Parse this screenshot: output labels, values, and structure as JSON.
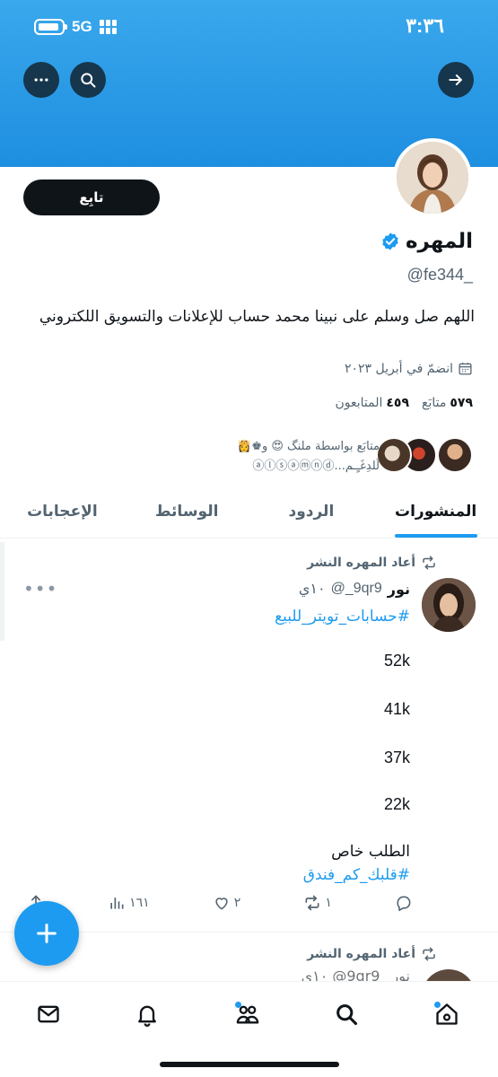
{
  "status_bar": {
    "time": "٣:٣٦",
    "network": "5G"
  },
  "header": {
    "back_icon": "arrow-right-icon",
    "search_icon": "search-icon",
    "more_icon": "more-icon"
  },
  "profile": {
    "follow_label": "تابِع",
    "name": "المهره",
    "handle": "@fe344_",
    "bio": "اللهم صل وسلم على نبينا محمد حساب للإعلانات والتسويق اللكتروني",
    "joined": "انضمّ في أبريل ٢٠٢٣",
    "following_count": "٥٧٩",
    "following_label": "متابَع",
    "followers_count": "٤٥٩",
    "followers_label": "المتابعون",
    "followed_by_line1": "متابَع بواسطة ملنگ 😍 و♚👸",
    "followed_by_line2": "لَلدِغَـٍـم...ⓐⓛⓢⓐⓜⓝⓓ"
  },
  "tabs": [
    {
      "label": "المنشورات",
      "active": true
    },
    {
      "label": "الردود",
      "active": false
    },
    {
      "label": "الوسائط",
      "active": false
    },
    {
      "label": "الإعجابات",
      "active": false
    }
  ],
  "post": {
    "repost_label": "أعاد المهره النشر",
    "author_name": "نور",
    "author_handle": "9qr9_@",
    "time": "١٠ي",
    "hashtag1": "#حسابات_تويتر_للبيع",
    "lines": [
      "52k",
      "41k",
      "37k",
      "22k"
    ],
    "request": "الطلب خاص",
    "hashtag2": "#قلبك_كم_فندق",
    "retweets": "١",
    "likes": "٢",
    "views": "١٦١"
  },
  "post2": {
    "repost_label": "أعاد المهره النشر",
    "partial": "نور _9qr9@ ١٠ي"
  },
  "nav": [
    "home-icon",
    "search-icon",
    "communities-icon",
    "notifications-icon",
    "messages-icon"
  ],
  "colors": {
    "accent": "#1d9bf0",
    "banner": "#2196e6",
    "text": "#0f1419",
    "muted": "#536471"
  }
}
